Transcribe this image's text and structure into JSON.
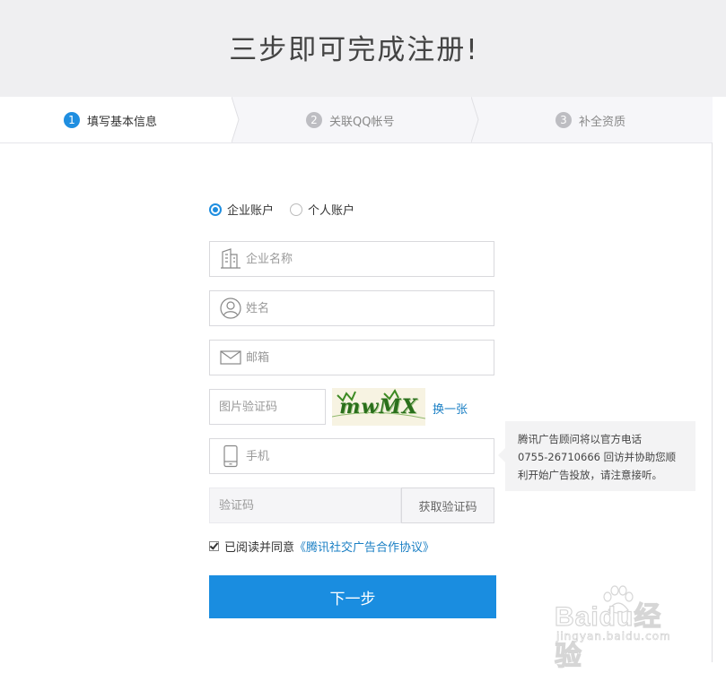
{
  "header": {
    "title": "三步即可完成注册!"
  },
  "steps": [
    {
      "num": "1",
      "label": "填写基本信息",
      "active": true
    },
    {
      "num": "2",
      "label": "关联QQ帐号",
      "active": false
    },
    {
      "num": "3",
      "label": "补全资质",
      "active": false
    }
  ],
  "account_type": {
    "options": [
      {
        "label": "企业账户",
        "selected": true
      },
      {
        "label": "个人账户",
        "selected": false
      }
    ]
  },
  "form": {
    "company_name": {
      "placeholder": "企业名称",
      "value": "",
      "icon": "building-icon"
    },
    "name": {
      "placeholder": "姓名",
      "value": "",
      "icon": "user-icon"
    },
    "email": {
      "placeholder": "邮箱",
      "value": "",
      "icon": "mail-icon"
    },
    "captcha": {
      "placeholder": "图片验证码",
      "value": "",
      "image_text": "mwMX",
      "refresh_label": "换一张"
    },
    "phone": {
      "placeholder": "手机",
      "value": "",
      "icon": "phone-icon"
    },
    "sms_code": {
      "placeholder": "验证码",
      "value": "",
      "get_code_label": "获取验证码"
    },
    "agreement": {
      "checked": true,
      "prefix": "已阅读并同意",
      "link_text": "《腾讯社交广告合作协议》"
    },
    "next_label": "下一步"
  },
  "tooltip": {
    "lines": [
      "腾讯广告顾问将以官方电话",
      "0755-26710666 回访并协助您顺",
      "利开始广告投放，请注意接听。"
    ]
  },
  "watermark": {
    "logo": "Baidu经验",
    "url": "jingyan.baidu.com"
  },
  "colors": {
    "accent": "#1a8de0",
    "link": "#1a7fc4",
    "header_bg": "#efeff1",
    "captcha_text": "#2a6f1b"
  }
}
